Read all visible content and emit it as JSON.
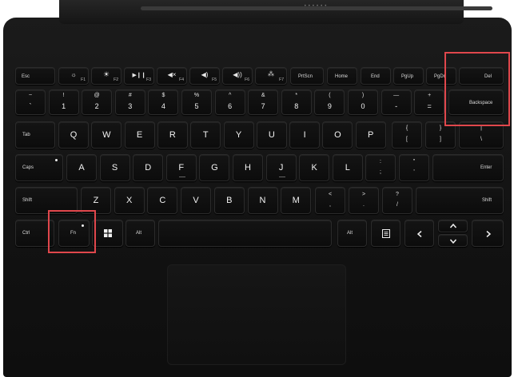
{
  "colors": {
    "highlight": "#e0474c",
    "keyboard": "#121212",
    "key_text": "#f0f0f0"
  },
  "row_fn": [
    "Esc",
    "F1",
    "F2",
    "F3",
    "F4",
    "F5",
    "F6",
    "F7",
    "PrtScn",
    "Home",
    "End",
    "PgUp",
    "PgDn",
    "Del"
  ],
  "row_num": [
    {
      "top": "~",
      "bottom": "`"
    },
    {
      "top": "!",
      "bottom": "1"
    },
    {
      "top": "@",
      "bottom": "2"
    },
    {
      "top": "#",
      "bottom": "3"
    },
    {
      "top": "$",
      "bottom": "4"
    },
    {
      "top": "%",
      "bottom": "5"
    },
    {
      "top": "^",
      "bottom": "6"
    },
    {
      "top": "&",
      "bottom": "7"
    },
    {
      "top": "*",
      "bottom": "8"
    },
    {
      "top": "(",
      "bottom": "9"
    },
    {
      "top": ")",
      "bottom": "0"
    },
    {
      "top": "—",
      "bottom": "-"
    },
    {
      "top": "+",
      "bottom": "="
    }
  ],
  "backspace": "Backspace",
  "tab": "Tab",
  "row_q": [
    "Q",
    "W",
    "E",
    "R",
    "T",
    "Y",
    "U",
    "I",
    "O",
    "P"
  ],
  "brackets": [
    {
      "top": "{",
      "bottom": "["
    },
    {
      "top": "}",
      "bottom": "]"
    },
    {
      "top": "|",
      "bottom": "\\"
    }
  ],
  "caps": "Caps",
  "row_a": [
    "A",
    "S",
    "D",
    "F",
    "G",
    "H",
    "J",
    "K",
    "L"
  ],
  "semi": [
    {
      "top": ":",
      "bottom": ";"
    },
    {
      "top": "\"",
      "bottom": "'"
    }
  ],
  "enter": "Enter",
  "shift_left": "Shift",
  "row_z": [
    "Z",
    "X",
    "C",
    "V",
    "B",
    "N",
    "M"
  ],
  "punct": [
    {
      "top": "<",
      "bottom": ","
    },
    {
      "top": ">",
      "bottom": "."
    },
    {
      "top": "?",
      "bottom": "/"
    }
  ],
  "shift_right": "Shift",
  "bottom": {
    "ctrl": "Ctrl",
    "fn": "Fn",
    "alt_left": "Alt",
    "alt_right": "Alt"
  },
  "icons": [
    "windows-icon",
    "menu-icon",
    "arrow-left-icon",
    "arrow-up-icon",
    "arrow-down-icon",
    "arrow-right-icon",
    "brightness-down-icon",
    "brightness-up-icon",
    "play-pause-icon",
    "mute-icon",
    "volume-down-icon",
    "volume-up-icon",
    "backlight-icon"
  ]
}
